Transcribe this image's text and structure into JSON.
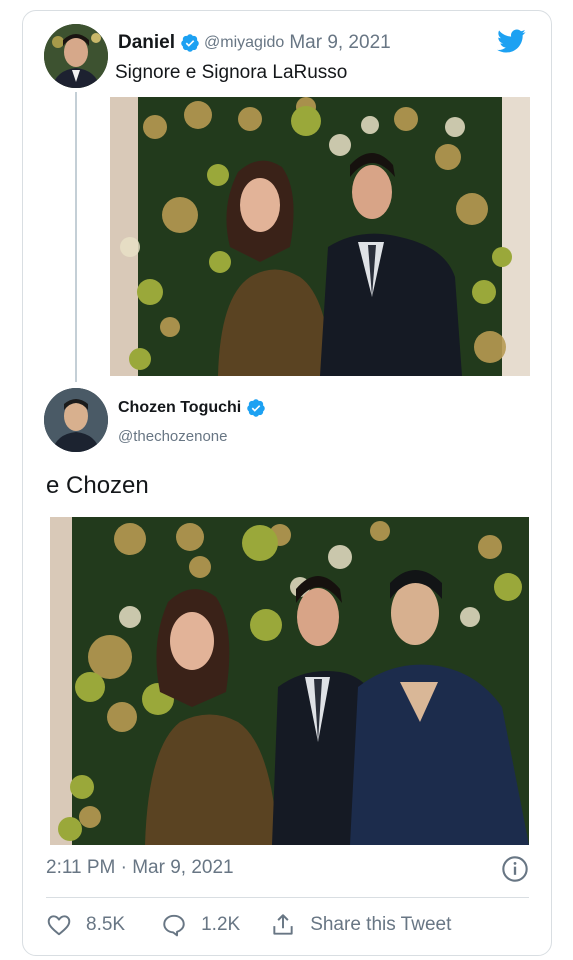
{
  "parent_tweet": {
    "name": "Daniel",
    "handle": "@miyagido",
    "date": "Mar 9, 2021",
    "text": "Signore e Signora LaRusso"
  },
  "main_tweet": {
    "name": "Chozen Toguchi",
    "handle": "@thechozenone",
    "text": "e Chozen",
    "timestamp": "2:11 PM · Mar 9, 2021"
  },
  "actions": {
    "likes": "8.5K",
    "replies": "1.2K",
    "share_label": "Share this Tweet"
  },
  "icons": {
    "brand": "twitter-bird-icon",
    "verified": "verified-badge-icon",
    "info": "info-icon",
    "like": "heart-icon",
    "reply": "reply-bubble-icon",
    "share": "share-icon"
  },
  "colors": {
    "twitter_blue": "#1da1f2",
    "text_primary": "#14171a",
    "text_secondary": "#687684",
    "border": "#d9dee2"
  }
}
